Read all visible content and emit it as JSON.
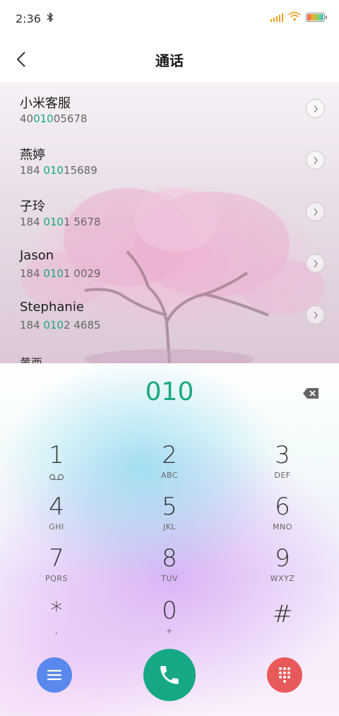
{
  "status_bar": {
    "time": "2:36",
    "battery_level": 1.0
  },
  "header": {
    "title": "通话",
    "back_icon": "chevron-left-icon"
  },
  "contacts": [
    {
      "name": "小米客服",
      "number_pre": "40",
      "number_match": "010",
      "number_post": "05678"
    },
    {
      "name": "燕婷",
      "number_pre": "184 ",
      "number_match": "010",
      "number_post": "15689"
    },
    {
      "name": "子玲",
      "number_pre": "184 ",
      "number_match": "010",
      "number_post": "1 5678"
    },
    {
      "name": "Jason",
      "number_pre": "184 ",
      "number_match": "010",
      "number_post": "1 0029"
    },
    {
      "name": "Stephanie",
      "number_pre": "184 ",
      "number_match": "010",
      "number_post": "2 4685"
    }
  ],
  "partial_contact": {
    "name": "黄西"
  },
  "dialer": {
    "input": "010",
    "keys": [
      {
        "digit": "1",
        "letters": ""
      },
      {
        "digit": "2",
        "letters": "ABC"
      },
      {
        "digit": "3",
        "letters": "DEF"
      },
      {
        "digit": "4",
        "letters": "GHI"
      },
      {
        "digit": "5",
        "letters": "JKL"
      },
      {
        "digit": "6",
        "letters": "MNO"
      },
      {
        "digit": "7",
        "letters": "PQRS"
      },
      {
        "digit": "8",
        "letters": "TUV"
      },
      {
        "digit": "9",
        "letters": "WXYZ"
      },
      {
        "digit": "*",
        "letters": ","
      },
      {
        "digit": "0",
        "letters": "+"
      },
      {
        "digit": "#",
        "letters": ""
      }
    ]
  },
  "colors": {
    "accent": "#18a87a",
    "call": "#16a885",
    "menu": "#5a88ec",
    "keypad": "#e85a5a"
  },
  "icons": {
    "menu": "menu-icon",
    "call": "phone-icon",
    "keypad": "keypad-icon",
    "delete": "backspace-icon",
    "detail": "chevron-right-icon"
  }
}
